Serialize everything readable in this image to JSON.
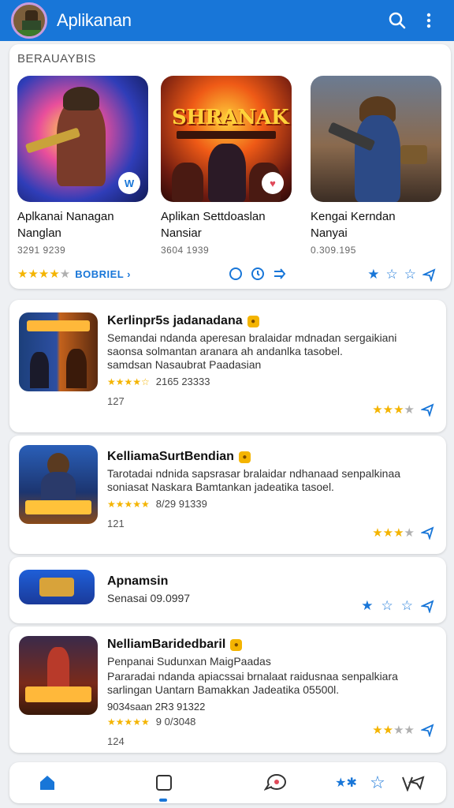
{
  "header": {
    "title": "Aplikanan",
    "search_icon": "search-icon",
    "menu_icon": "more-vert-icon"
  },
  "featured": {
    "label": "BERAUAYBIS",
    "cards": [
      {
        "title_line1": "Aplkanai Nanagan",
        "title_line2": "Nanglan",
        "meta": "3291 9239",
        "rating": 4,
        "link": "BOBRIEL",
        "badge": "W"
      },
      {
        "title_line1": "Aplikan Settdoaslan",
        "title_line2": "Nansiar",
        "meta": "3604 1939",
        "art_title": "SHRANAK",
        "badge": "♥"
      },
      {
        "title_line1": "Kengai Kerndan",
        "title_line2": "Nanyai",
        "meta": "0.309.195"
      }
    ]
  },
  "list": [
    {
      "title": "Kerlinpr5s jadanadana",
      "desc_line1": "Semandai ndanda aperesan bralaidar mdnadan sergaikiani",
      "desc_line2": "saonsa solmantan aranara ah andanlka tasobel.",
      "desc_line3": "samdsan Nasaubrat Paadasian",
      "stars": "★★★★☆",
      "meta": "2165 23333",
      "count": "127",
      "rating": 4
    },
    {
      "title": "KelliamaSurtBendian",
      "desc_line1": "Tarotadai ndnida sapsrasar bralaidar ndhanaad senpalkinaa",
      "desc_line2": "soniasat Naskara Bamtankan jadeatika tasoel.",
      "stars": "★★★★★",
      "meta": "8/29 91339",
      "count": "121",
      "rating": 3.5
    },
    {
      "title": "Apnamsin",
      "sub": "Senasai 09.0997",
      "rating": 3
    },
    {
      "title": "NelliamBaridedbaril",
      "sub": "Penpanai Sudunxan MaigPaadas",
      "desc_line1": "Pararadai ndanda apiacssai brnalaat raidusnaa senpalkiara",
      "desc_line2": "sarlingan Uantarn Bamakkan Jadeatika 05500l.",
      "stars": "★★★★★",
      "meta": "9034saan 2R3 91322",
      "meta2": "9 0/3048",
      "count": "124",
      "rating": 2.5
    }
  ],
  "nav": {
    "home_icon": "home-icon",
    "square_icon": "square-icon",
    "chat_icon": "chat-bubble-icon",
    "stars_icon": "stars-icon",
    "star_outline_icon": "star-outline-icon",
    "share_icon": "share-icon"
  },
  "colors": {
    "primary": "#1876d8",
    "star": "#f4b400"
  }
}
